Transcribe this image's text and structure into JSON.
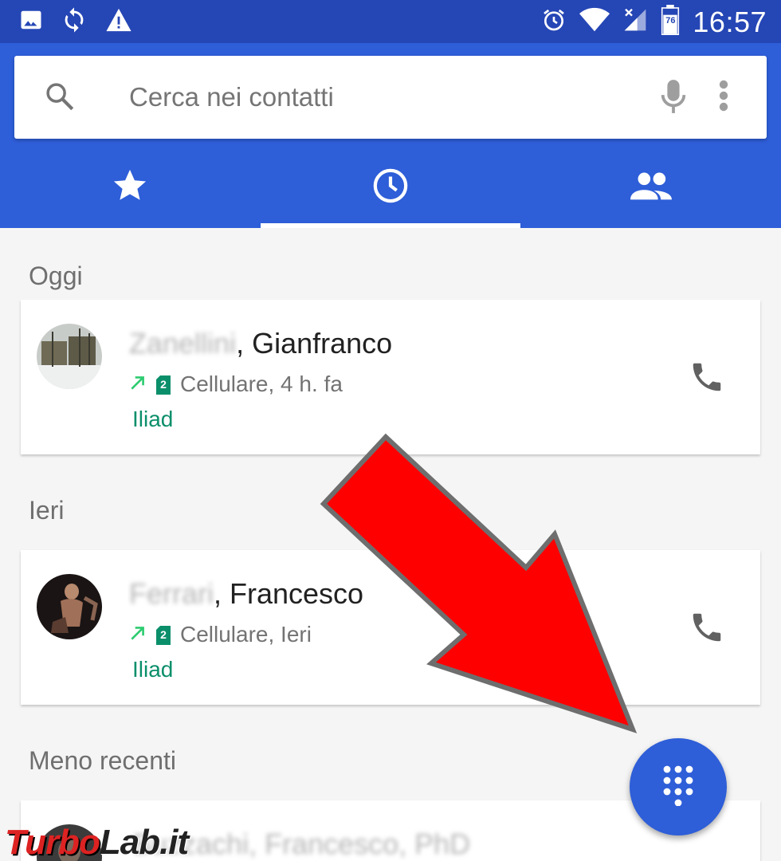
{
  "status_bar": {
    "time": "16:57",
    "battery_level": "76",
    "left_icons": [
      "image-icon",
      "sync-icon",
      "warning-icon"
    ],
    "right_icons": [
      "alarm-icon",
      "wifi-icon",
      "signal-icon",
      "battery-icon"
    ]
  },
  "search": {
    "placeholder": "Cerca nei contatti"
  },
  "tabs": [
    {
      "icon": "star-icon",
      "selected": false
    },
    {
      "icon": "clock-icon",
      "selected": true
    },
    {
      "icon": "people-icon",
      "selected": false
    }
  ],
  "sections": [
    {
      "header": "Oggi",
      "entry": {
        "surname": "Zanellini",
        "name": ", Gianfranco",
        "detail": "Cellulare, 4 h. fa",
        "sim": "2",
        "carrier": "Iliad"
      }
    },
    {
      "header": "Ieri",
      "entry": {
        "surname": "Ferrari",
        "name": ", Francesco",
        "detail": "Cellulare, Ieri",
        "sim": "2",
        "carrier": "Iliad"
      }
    },
    {
      "header": "Meno recenti",
      "entry": {
        "surname": "Buzzachi, Francesco, PhD"
      }
    }
  ],
  "watermark": {
    "part1": "Turbo",
    "part2": "Lab.it"
  },
  "colors": {
    "status_bar": "#2546b5",
    "primary": "#2e5ed8",
    "carrier_green": "#0b8f6b",
    "outgoing_arrow": "#2ecc71",
    "arrow_red": "#ff0000"
  }
}
